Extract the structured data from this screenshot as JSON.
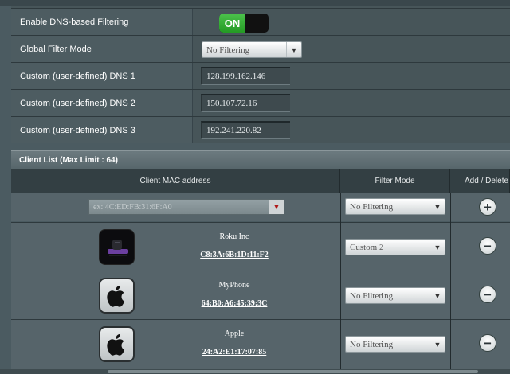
{
  "settings": {
    "dns_filtering": {
      "label": "Enable DNS-based Filtering",
      "state": "ON"
    },
    "global_mode": {
      "label": "Global Filter Mode",
      "value": "No Filtering"
    },
    "dns1": {
      "label": "Custom (user-defined) DNS 1",
      "value": "128.199.162.146"
    },
    "dns2": {
      "label": "Custom (user-defined) DNS 2",
      "value": "150.107.72.16"
    },
    "dns3": {
      "label": "Custom (user-defined) DNS 3",
      "value": "192.241.220.82"
    }
  },
  "client_list": {
    "title": "Client List (Max Limit : 64)",
    "headers": {
      "mac": "Client MAC address",
      "mode": "Filter Mode",
      "action": "Add / Delete"
    },
    "new_entry": {
      "mac_placeholder": "ex: 4C:ED:FB:31:6F:A0",
      "mode": "No Filtering"
    },
    "clients": [
      {
        "name": "Roku Inc",
        "mac": "C8:3A:6B:1D:11:F2",
        "mode": "Custom 2",
        "icon": "roku-device-icon"
      },
      {
        "name": "MyPhone",
        "mac": "64:B0:A6:45:39:3C",
        "mode": "No Filtering",
        "icon": "apple-icon"
      },
      {
        "name": "Apple",
        "mac": "24:A2:E1:17:07:85",
        "mode": "No Filtering",
        "icon": "apple-icon"
      }
    ]
  },
  "colors": {
    "toggle_on": "#2fa82f",
    "background": "#4b5b61",
    "header": "#333f43"
  }
}
